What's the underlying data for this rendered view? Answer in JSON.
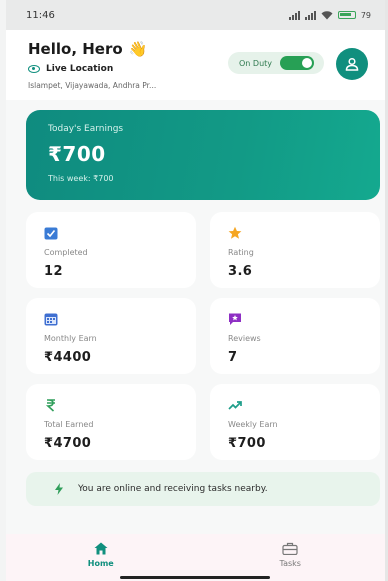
{
  "status_bar": {
    "time": "11:46",
    "battery": "79"
  },
  "header": {
    "greeting": "Hello, Hero",
    "wave_emoji": "👋",
    "location_label": "Live Location",
    "address": "Islampet, Vijayawada, Andhra Pr...",
    "duty_label": "On Duty",
    "duty_on": true
  },
  "earnings": {
    "title": "Today's Earnings",
    "amount": "₹700",
    "week": "This week: ₹700"
  },
  "stats": [
    {
      "icon": "check-square-icon",
      "label": "Completed",
      "value": "12",
      "color": "#3a7bd5"
    },
    {
      "icon": "star-icon",
      "label": "Rating",
      "value": "3.6",
      "color": "#f5a623"
    },
    {
      "icon": "calendar-icon",
      "label": "Monthly Earn",
      "value": "₹4400",
      "color": "#3f6fd1"
    },
    {
      "icon": "review-icon",
      "label": "Reviews",
      "value": "7",
      "color": "#8e2fc4"
    },
    {
      "icon": "rupee-icon",
      "label": "Total Earned",
      "value": "₹4700",
      "color": "#2f9e5a"
    },
    {
      "icon": "trending-up-icon",
      "label": "Weekly Earn",
      "value": "₹700",
      "color": "#1e9e8a"
    }
  ],
  "banner": {
    "text": "You are online and receiving tasks nearby."
  },
  "nav": [
    {
      "icon": "home-icon",
      "label": "Home",
      "active": true
    },
    {
      "icon": "briefcase-icon",
      "label": "Tasks",
      "active": false
    }
  ],
  "colors": {
    "primary": "#108f7e",
    "online_green": "#27a055"
  }
}
